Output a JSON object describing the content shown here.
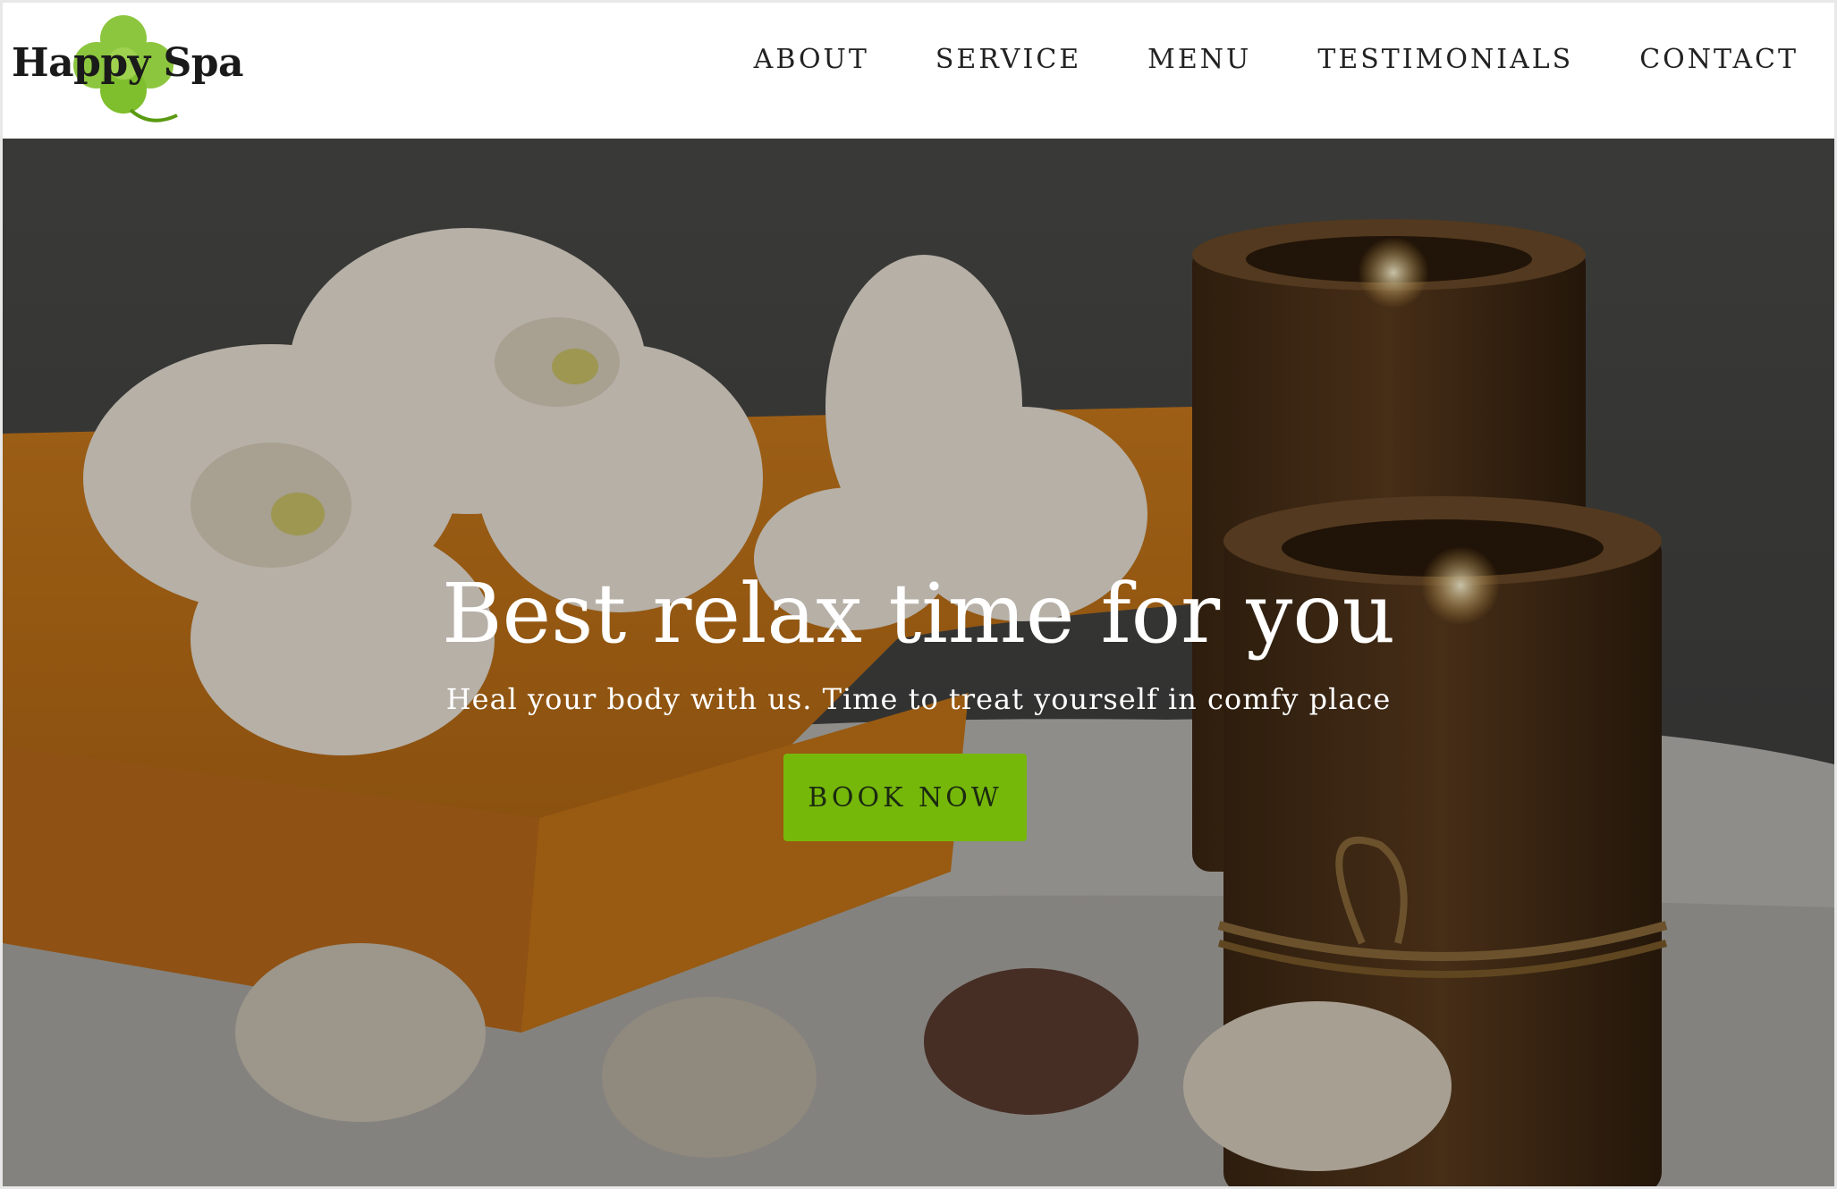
{
  "brand": {
    "name": "Happy Spa",
    "accent_color": "#76b80a",
    "logo_icon": "clover-icon"
  },
  "nav": {
    "items": [
      {
        "label": "ABOUT"
      },
      {
        "label": "SERVICE"
      },
      {
        "label": "MENU"
      },
      {
        "label": "TESTIMONIALS"
      },
      {
        "label": "CONTACT"
      }
    ]
  },
  "hero": {
    "title": "Best relax time for you",
    "subtitle": "Heal your body with us. Time to treat yourself in comfy place",
    "cta_label": "BOOK NOW",
    "background_image": "spa-still-life-image"
  }
}
